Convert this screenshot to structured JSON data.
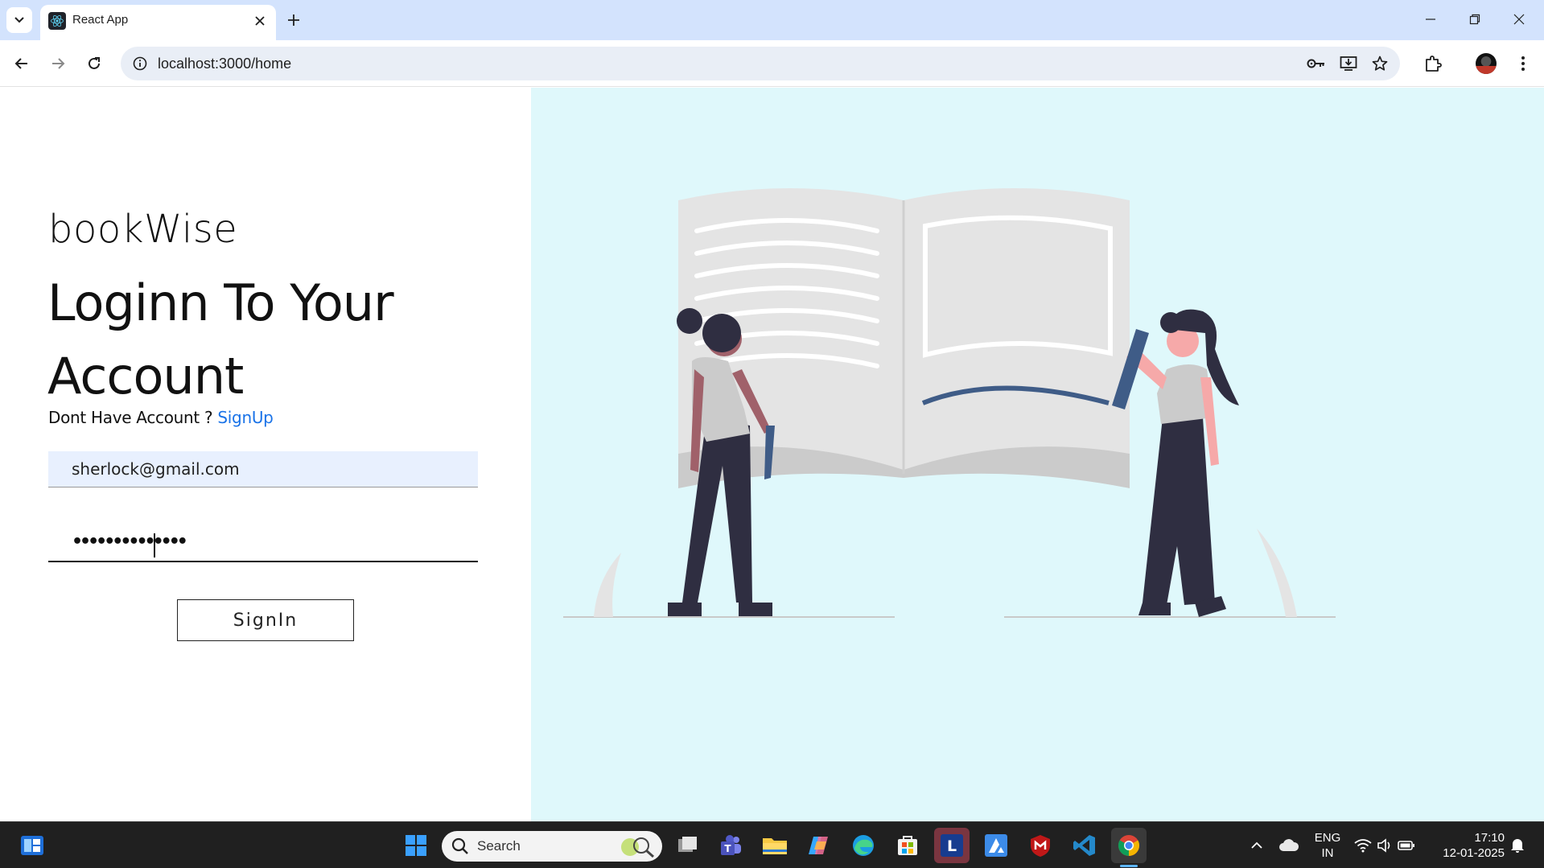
{
  "browser": {
    "tab_title": "React App",
    "url": "localhost:3000/home"
  },
  "app": {
    "brand": "bookWise",
    "heading": "Loginn To Your Account",
    "signup_prompt": "Dont Have Account ? ",
    "signup_link": "SignUp",
    "email_value": "sherlock@gmail.com",
    "password_masked": "••••••••••••••",
    "signin_label": "SignIn"
  },
  "taskbar": {
    "search_label": "Search",
    "language": "ENG",
    "region": "IN",
    "time": "17:10",
    "date": "12-01-2025"
  },
  "colors": {
    "tabbar": "#d3e3fd",
    "illustration_bg": "#dff8fb",
    "link": "#1a73e8",
    "email_bg": "#e8f0fe",
    "accent_blue": "#3f5c87",
    "figure_dark": "#2f2e41",
    "skin": "#f6a9a9"
  }
}
